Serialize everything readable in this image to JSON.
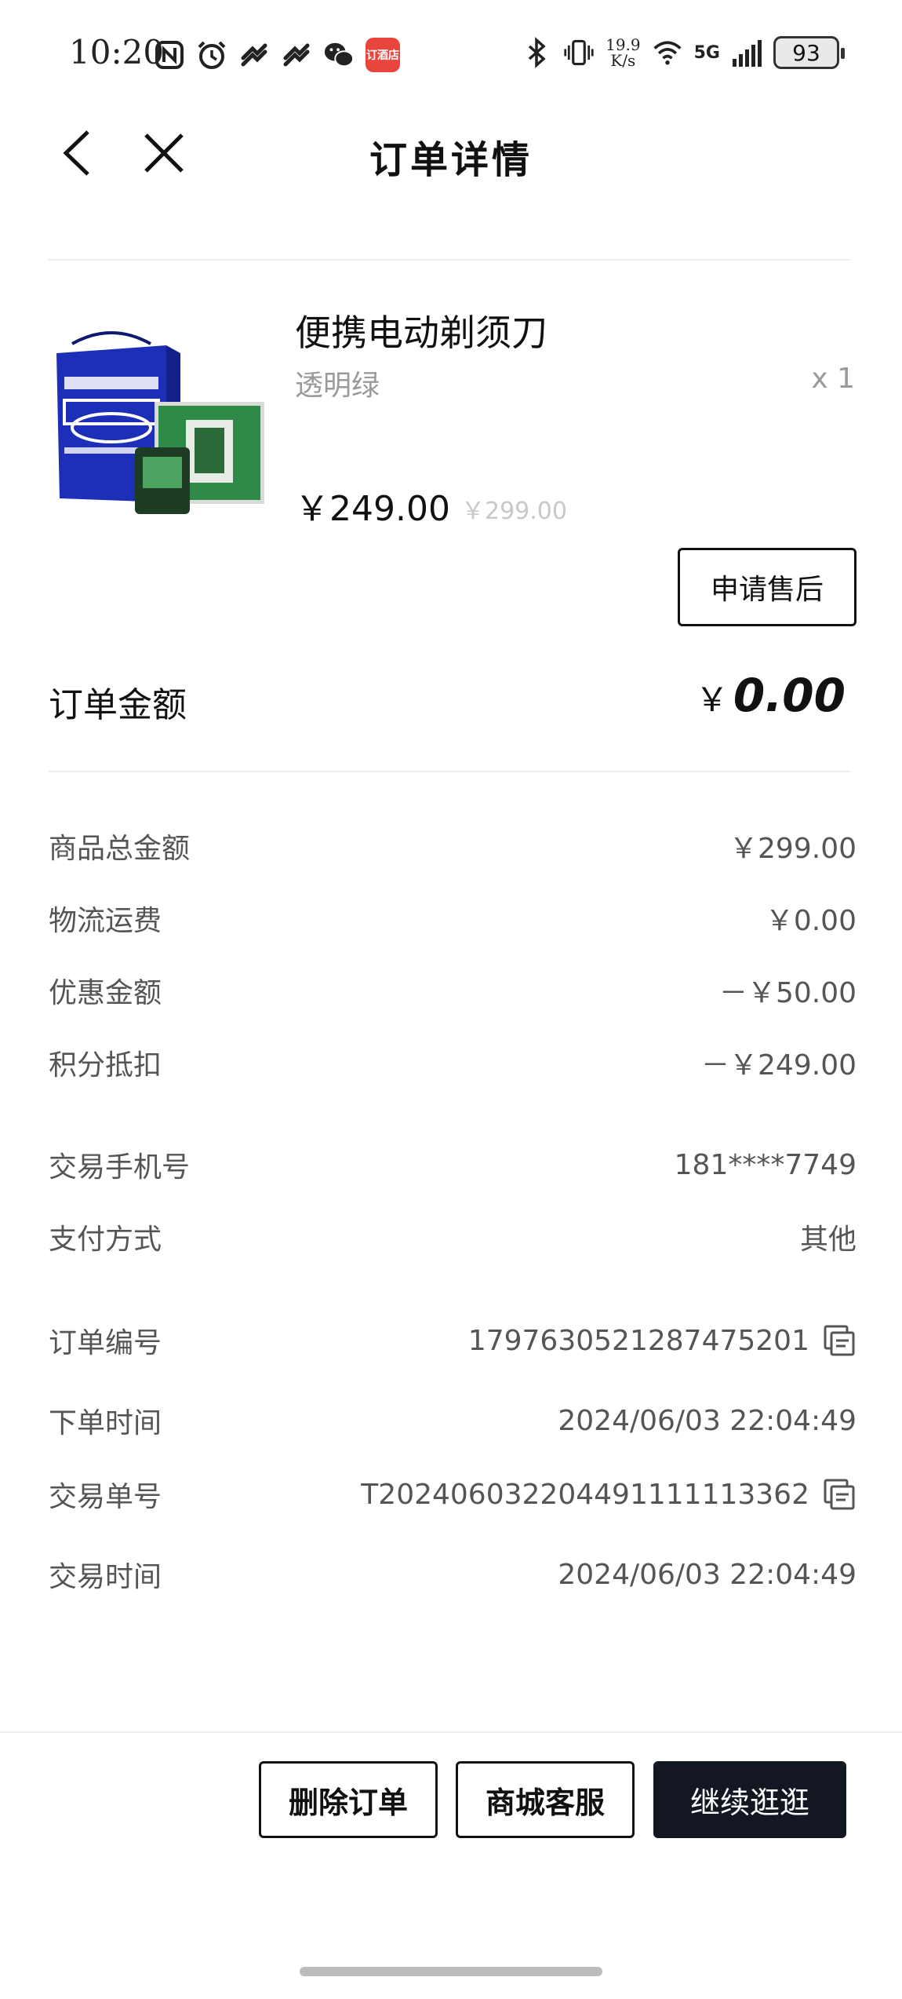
{
  "status_bar": {
    "time": "10:20",
    "speed_top": "19.9",
    "speed_bottom": "K/s",
    "network": "5G",
    "battery": "93",
    "app_badge": "订酒店"
  },
  "header": {
    "title": "订单详情"
  },
  "product": {
    "name": "便携电动剃须刀",
    "variant": "透明绿",
    "quantity": "x 1",
    "price": "￥249.00",
    "original_price": "￥299.00",
    "image_alt": "ICE SHAVER product box",
    "aftersale_label": "申请售后"
  },
  "order_amount": {
    "label": "订单金额",
    "currency": "￥",
    "value": "0.00"
  },
  "price_rows": [
    {
      "label": "商品总金额",
      "value": "￥299.00"
    },
    {
      "label": "物流运费",
      "value": "￥0.00"
    },
    {
      "label": "优惠金额",
      "value": "－￥50.00"
    },
    {
      "label": "积分抵扣",
      "value": "－￥249.00"
    }
  ],
  "info_rows": [
    {
      "label": "交易手机号",
      "value": "181****7749"
    },
    {
      "label": "支付方式",
      "value": "其他"
    }
  ],
  "order_rows": [
    {
      "label": "订单编号",
      "value": "1797630521287475201"
    },
    {
      "label": "下单时间",
      "value": "2024/06/03 22:04:49"
    },
    {
      "label": "交易单号",
      "value": "T202406032204491111113362"
    },
    {
      "label": "交易时间",
      "value": "2024/06/03 22:04:49"
    }
  ],
  "actions": {
    "delete": "删除订单",
    "service": "商城客服",
    "continue": "继续逛逛"
  },
  "colors": {
    "primary_button": "#121722",
    "muted_text": "#9a9a9a",
    "divider": "#ececec"
  }
}
